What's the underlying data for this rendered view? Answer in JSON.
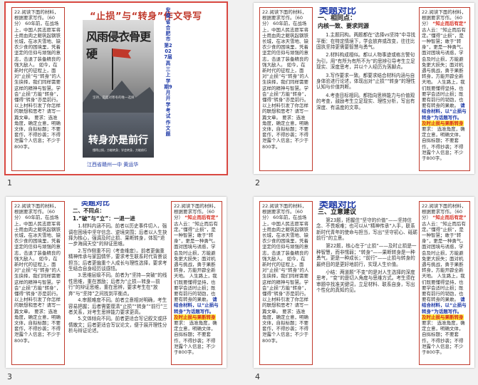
{
  "slides": [
    {
      "number": "1"
    },
    {
      "number": "2"
    },
    {
      "number": "3"
    },
    {
      "number": "4"
    }
  ],
  "left_panel": {
    "text": "22.阅读下面的材料，根据要求写作。（60分）    60年前，在战场上，中国人民志愿军将士用血肉之躯筑起钢铁长城，在冰天雪地、缺衣少食的困境里，凭着坚定的信仰与顽强的意志，击退了装备精良的强大敌人。    如今，在新时代的征程上，面对“止损”与“转身”的人生抉择，我们同样需要这样的精神与智慧。学会“止损”方能“转身”，懂得“转身”亦是前行。    以上材料引发了你怎样的联想和思考？请写一篇文章。    要求：选准角度，确定立意，明确文体，自拟标题；不要套作，不得抄袭；不得泄露个人信息；不少于800字。"
  },
  "right_panel": {
    "intro": "22.阅读下面的材料，根据要求写作。（60分）",
    "text1": "古人云：“知止而后有定。”懂得“止损”，是一种智慧；敢于“转身”，更是一种勇气。面对困境与诱惑，学会及时止损，方能避免更大损失；面对机遇与挑战，勇于果断转身，方能开辟全新天地。",
    "highlight_red": "“知止而后有定”",
    "text2": "人生路上，我们既要懂得坚持，也要学会适时止损；既要有前行的韧劲，也要有转身的果敢。",
    "text3": "请结合材料，以“止损与转身”为话题写作。",
    "highlight_yellow": "及时止损与果断转身",
    "label": "要求：",
    "text4": "选准角度，确定立意，明确文体，自拟标题；不要套作，不得抄袭；不得泄露个人信息；不少于800字。"
  },
  "slide1": {
    "title": "“止损”与“转身”作文导写",
    "poster_title_1": "风雨侵衣骨更硬",
    "poster_small": "坚持，是面对寒冬的唯一选择",
    "poster_title_2": "转身亦是前行",
    "poster_caption": "懂得止损，方能转身；学会转身，方能前行",
    "author": "江西省赣州一中  黄运华",
    "vertical_text": "安徽省合肥市第2027届高三上学期9月开学考试作文题"
  },
  "slide2": {
    "heading": "类题对比",
    "sub1": "一、相同点：",
    "sub2": "内核一致、要求同源",
    "p1": "1.主题同构。两题都在“选择vs坚持”中寻找平衡：在特定情境下，学会放弃或改变，往往比固执坚持更需要智慧与勇气。",
    "p2": "2.材料构成相似。都以人物事迹或格言警句为引，用“有所为有所不为”的思辨引导考生立足现实、深度思考，并以个人经历为落脚点。",
    "p3": "3.写作要求一致。都要求结合材料内涵与自身体验进行论述，体现出对“止损”“转身”的理性认知与价值判断。",
    "p4": "4.考查目标相同。都指向思辨能力与价值观的考查，鼓励考生立足现实、理性分析，写出有深度、有温度的文章。"
  },
  "slide3": {
    "heading": "类题对比",
    "sub1": "二、不同点：",
    "sub2": "1.“破”与“立”：一退一进",
    "p1": "1.材料内涵不同。前者以历史事件切入，强调在困境中坚守信念、逆境突围；后者以人生抉择为核心，强调及时止损、果断转身，体现“退一步海阔天空”的辩证思维。",
    "p2": "2.写作侧重不同（考查维度）。前者更偏重精神传承与家国情怀，要求考生联系时代背景谈担当；后者更偏重个人成长与理性选择，要求考生结合自身经历谈感悟。",
    "p3": "3.思维层级不同。前者为“坚持—突破”的线性思维，重在激励；后者为“止损—转身—前行”的辩证思维，重在思辨，要求考生在“放弃”与“坚持”之间找到平衡点。",
    "p4": "4.审题难度不同。前者立意相对明确，考生容易把握；后者需要厘清“止损”“转身”“前行”三者关系，对考生思辨能力要求更高。",
    "p5": "5.文体倾向不同。前者更适合写记叙文或抒情散文；后者更适合写议论文，便于展开理性分析与辩证论述。"
  },
  "slide4": {
    "heading": "类题对比",
    "sub1": "三、立意建议",
    "p1": "第23题，把握住“坚守的价值”——坚持信念、不畏艰难；也可以从“精神传承”入手，联系新时代青年的使命与担当，写出“坚守初心、砥砺前行”的立意。",
    "p2": "第22题，核心在于“止损”——及时止损是一种智慧，而非懦弱；“转身”——果断转身是一种勇气，更是一种成长；“前行”——止损与转身的最终目的是更好地前行，实现人生价值。",
    "p3": "小结：两道题“不变”的是对人生选择的深度思考，“变”的是切入角度与思维方式。考生须在审题中找准关键词，立足材料、联系自身，写出个性化的真知灼见。"
  },
  "colors": {
    "accent_red": "#c0392b",
    "accent_blue": "#1f3aa6",
    "highlight_yellow": "#ffeb3b"
  }
}
